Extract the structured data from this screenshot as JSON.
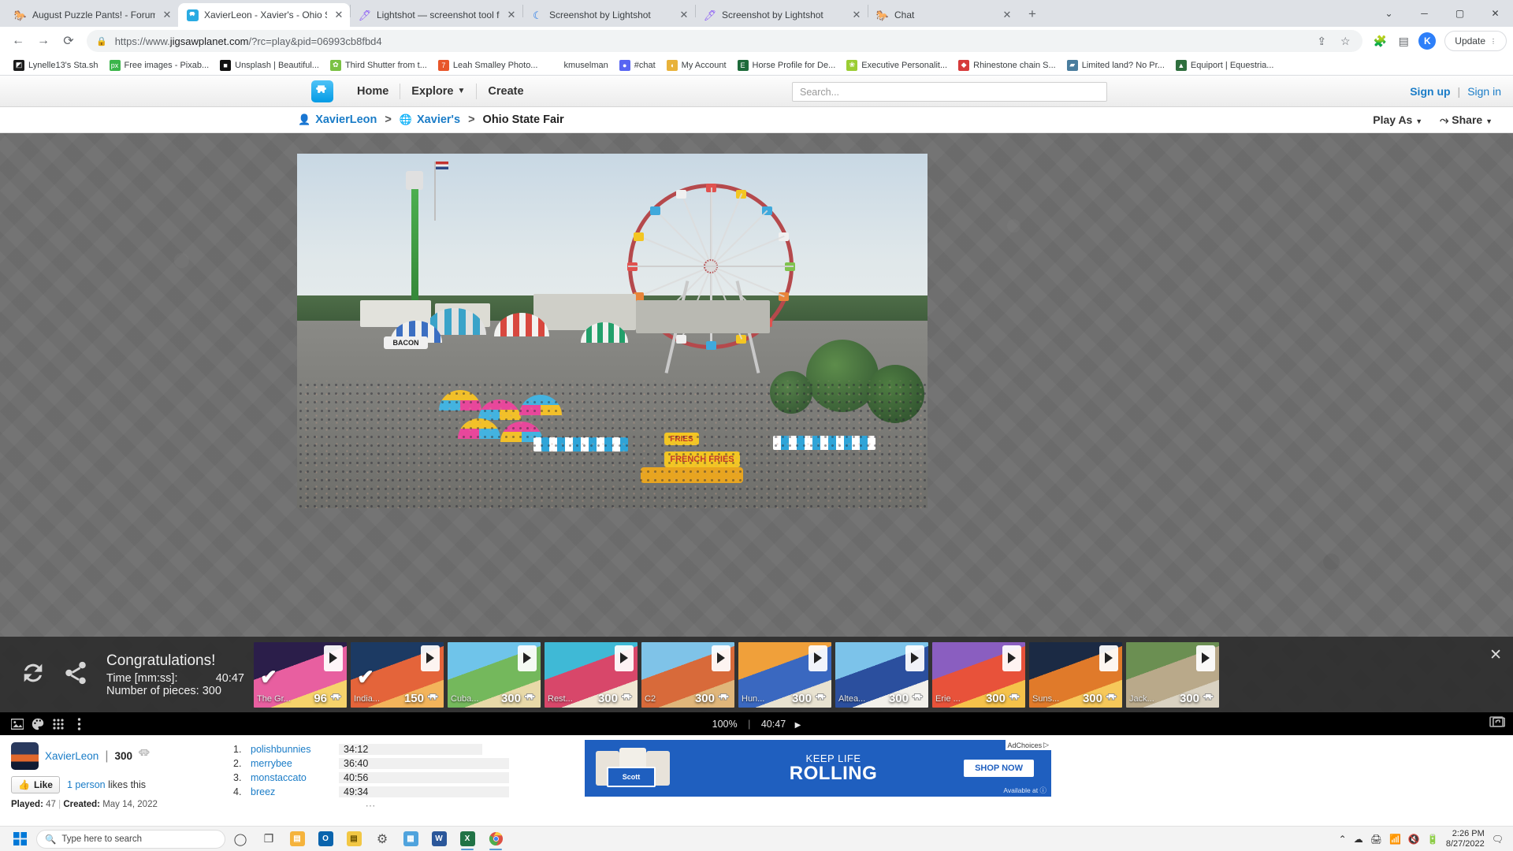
{
  "browser": {
    "tabs": [
      {
        "title": "August Puzzle Pants! - Forum Top",
        "favicon": "horse-icon",
        "active": false
      },
      {
        "title": "XavierLeon - Xavier's - Ohio State",
        "favicon": "jigsaw-icon",
        "active": true
      },
      {
        "title": "Lightshot — screenshot tool for",
        "favicon": "feather-icon",
        "active": false
      },
      {
        "title": "Screenshot by Lightshot",
        "favicon": "moon-icon",
        "active": false
      },
      {
        "title": "Screenshot by Lightshot",
        "favicon": "feather-icon",
        "active": false
      },
      {
        "title": "Chat",
        "favicon": "horse-icon",
        "active": false
      }
    ],
    "new_tab_label": "+",
    "window_controls": [
      "⌄",
      "−",
      "☐",
      "✕"
    ],
    "url_prefix": "https://www.",
    "url_main": "jigsawplanet.com",
    "url_rest": "/?rc=play&pid=06993cb8fbd4",
    "lock_icon": "lock-icon",
    "profile_initial": "K",
    "update_label": "Update",
    "bookmarks": [
      {
        "label": "Lynelle13's Sta.sh",
        "color": "#1b1b1b",
        "glyph": "◩"
      },
      {
        "label": "Free images - Pixab...",
        "color": "#3bb54a",
        "glyph": "px"
      },
      {
        "label": "Unsplash | Beautiful...",
        "color": "#111111",
        "glyph": "■"
      },
      {
        "label": "Third Shutter from t...",
        "color": "#7ac143",
        "glyph": "✿"
      },
      {
        "label": "Leah Smalley Photo...",
        "color": "#e8562a",
        "glyph": "7"
      },
      {
        "label": "kmuselman",
        "color": "#ffffff",
        "glyph": "wix"
      },
      {
        "label": "#chat",
        "color": "#5865f2",
        "glyph": "●"
      },
      {
        "label": "My Account",
        "color": "#e8b23a",
        "glyph": "◖"
      },
      {
        "label": "Horse Profile for De...",
        "color": "#1e6b3a",
        "glyph": "E"
      },
      {
        "label": "Executive Personalit...",
        "color": "#9acd32",
        "glyph": "❀"
      },
      {
        "label": "Rhinestone chain S...",
        "color": "#d63a3a",
        "glyph": "◆"
      },
      {
        "label": "Limited land? No Pr...",
        "color": "#4a7d9e",
        "glyph": "▰"
      },
      {
        "label": "Equiport | Equestria...",
        "color": "#2f6f3e",
        "glyph": "▲"
      }
    ]
  },
  "site": {
    "logo_icon": "jigsaw-logo-icon",
    "nav": [
      {
        "label": "Home"
      },
      {
        "label": "Explore",
        "caret": "▼"
      },
      {
        "label": "Create"
      }
    ],
    "search_placeholder": "Search...",
    "sign_up": "Sign up",
    "auth_sep": "|",
    "sign_in": "Sign in",
    "breadcrumb": {
      "user_icon": "person-icon",
      "user": "XavierLeon",
      "sep1": ">",
      "globe_icon": "globe-icon",
      "gallery": "Xavier's",
      "sep2": ">",
      "current": "Ohio State Fair"
    },
    "play_as": "Play As",
    "play_as_caret": "▼",
    "share": "Share",
    "share_caret": "▼",
    "share_icon": "share-icon"
  },
  "congrats": {
    "refresh_icon": "restart-icon",
    "share_icon": "share-nodes-icon",
    "title": "Congratulations!",
    "time_label": "Time [mm:ss]:",
    "time_value": "40:47",
    "pieces_line": "Number of pieces: 300",
    "close": "✕",
    "thumbs": [
      {
        "name": "The Gr...",
        "pieces": "96",
        "done": true,
        "c1": "#2b1e4a",
        "c2": "#e85fa0",
        "c3": "#f6d36b"
      },
      {
        "name": "India...",
        "pieces": "150",
        "done": true,
        "c1": "#1c3a63",
        "c2": "#e4643a",
        "c3": "#f3b45b"
      },
      {
        "name": "Cuba...",
        "pieces": "300",
        "done": false,
        "c1": "#6fc4ea",
        "c2": "#74b85c",
        "c3": "#e8d9a8"
      },
      {
        "name": "Rest...",
        "pieces": "300",
        "done": false,
        "c1": "#3fb9d6",
        "c2": "#d8476a",
        "c3": "#f0e6d2"
      },
      {
        "name": "C2",
        "pieces": "300",
        "done": false,
        "c1": "#7fc3e8",
        "c2": "#d86a3a",
        "c3": "#e0b67a"
      },
      {
        "name": "Hun...",
        "pieces": "300",
        "done": false,
        "c1": "#f0a03a",
        "c2": "#3a68c0",
        "c3": "#e8e2d0"
      },
      {
        "name": "Altea...",
        "pieces": "300",
        "done": false,
        "c1": "#7cc3ea",
        "c2": "#2b4f9e",
        "c3": "#f2f0ea"
      },
      {
        "name": "Erie ...",
        "pieces": "300",
        "done": false,
        "c1": "#8a5ec0",
        "c2": "#e8523a",
        "c3": "#f5c24a"
      },
      {
        "name": "Suns...",
        "pieces": "300",
        "done": false,
        "c1": "#1b2a44",
        "c2": "#e07a2a",
        "c3": "#f6c85a"
      },
      {
        "name": "Jack...",
        "pieces": "300",
        "done": false,
        "c1": "#6b8f52",
        "c2": "#b9a98a",
        "c3": "#d9d2c2"
      }
    ]
  },
  "gamebar": {
    "icons": [
      "image-icon",
      "palette-icon",
      "grid-icon",
      "more-vertical-icon"
    ],
    "zoom": "100%",
    "separator": "|",
    "timer": "40:47",
    "play_glyph": "▶",
    "fullscreen_icon": "fullscreen-icon"
  },
  "info": {
    "owner": "XavierLeon",
    "pipe": "|",
    "pieces": "300",
    "piece_icon": "puzzle-piece-icon",
    "like_label": "Like",
    "thumb_up_icon": "thumbs-up-icon",
    "likes_link": "1 person",
    "likes_suffix": "likes this",
    "played_label": "Played:",
    "played_value": "47",
    "played_pipe": "|",
    "created_label": "Created:",
    "created_value": "May 14, 2022",
    "leaderboard": [
      {
        "rank": "1.",
        "name": "polishbunnies",
        "time": "34:12",
        "bar": 52
      },
      {
        "rank": "2.",
        "name": "merrybee",
        "time": "36:40",
        "bar": 65
      },
      {
        "rank": "3.",
        "name": "monstaccato",
        "time": "40:56",
        "bar": 76
      },
      {
        "rank": "4.",
        "name": "breez",
        "time": "49:34",
        "bar": 92
      }
    ],
    "more": "⋯"
  },
  "ad": {
    "adchoices": "AdChoices",
    "adchoices_glyph": "▷",
    "line1": "KEEP LIFE",
    "line2": "ROLLING",
    "button": "SHOP NOW",
    "available": "Available at ⓘ",
    "brand": "Scott"
  },
  "taskbar": {
    "start_icon": "windows-icon",
    "search_placeholder": "Type here to search",
    "search_icon": "search-icon",
    "apps": [
      {
        "name": "cortana-icon",
        "glyph": "○",
        "color": "transparent"
      },
      {
        "name": "task-view-icon",
        "glyph": "⌷",
        "color": "transparent"
      },
      {
        "name": "file-explorer-icon",
        "glyph": "🗀",
        "color": "#f5b33c"
      },
      {
        "name": "outlook-icon",
        "glyph": "O",
        "color": "#0a64ad"
      },
      {
        "name": "sticky-notes-icon",
        "glyph": "▤",
        "color": "#f2c744"
      },
      {
        "name": "settings-icon",
        "glyph": "⚙",
        "color": "#5a5a5a"
      },
      {
        "name": "calculator-icon",
        "glyph": "▦",
        "color": "#4fa3dd"
      },
      {
        "name": "word-icon",
        "glyph": "W",
        "color": "#2b579a"
      },
      {
        "name": "excel-icon",
        "glyph": "X",
        "color": "#217346"
      },
      {
        "name": "chrome-icon",
        "glyph": "◉",
        "color": "#dd5144"
      }
    ],
    "tray_icons": [
      "caret-up-icon",
      "onedrive-icon",
      "printer-icon",
      "wifi-icon",
      "volume-mute-icon",
      "battery-icon"
    ],
    "time": "2:26 PM",
    "date": "8/27/2022",
    "notification_icon": "notification-icon"
  }
}
